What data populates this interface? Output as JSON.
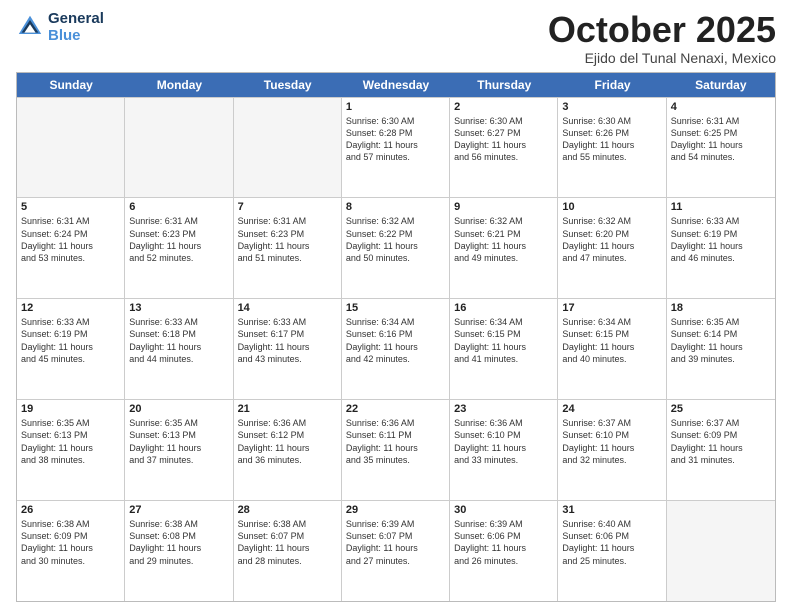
{
  "logo": {
    "line1": "General",
    "line2": "Blue"
  },
  "title": "October 2025",
  "location": "Ejido del Tunal Nenaxi, Mexico",
  "days": [
    "Sunday",
    "Monday",
    "Tuesday",
    "Wednesday",
    "Thursday",
    "Friday",
    "Saturday"
  ],
  "weeks": [
    [
      {
        "day": "",
        "info": ""
      },
      {
        "day": "",
        "info": ""
      },
      {
        "day": "",
        "info": ""
      },
      {
        "day": "1",
        "info": "Sunrise: 6:30 AM\nSunset: 6:28 PM\nDaylight: 11 hours\nand 57 minutes."
      },
      {
        "day": "2",
        "info": "Sunrise: 6:30 AM\nSunset: 6:27 PM\nDaylight: 11 hours\nand 56 minutes."
      },
      {
        "day": "3",
        "info": "Sunrise: 6:30 AM\nSunset: 6:26 PM\nDaylight: 11 hours\nand 55 minutes."
      },
      {
        "day": "4",
        "info": "Sunrise: 6:31 AM\nSunset: 6:25 PM\nDaylight: 11 hours\nand 54 minutes."
      }
    ],
    [
      {
        "day": "5",
        "info": "Sunrise: 6:31 AM\nSunset: 6:24 PM\nDaylight: 11 hours\nand 53 minutes."
      },
      {
        "day": "6",
        "info": "Sunrise: 6:31 AM\nSunset: 6:23 PM\nDaylight: 11 hours\nand 52 minutes."
      },
      {
        "day": "7",
        "info": "Sunrise: 6:31 AM\nSunset: 6:23 PM\nDaylight: 11 hours\nand 51 minutes."
      },
      {
        "day": "8",
        "info": "Sunrise: 6:32 AM\nSunset: 6:22 PM\nDaylight: 11 hours\nand 50 minutes."
      },
      {
        "day": "9",
        "info": "Sunrise: 6:32 AM\nSunset: 6:21 PM\nDaylight: 11 hours\nand 49 minutes."
      },
      {
        "day": "10",
        "info": "Sunrise: 6:32 AM\nSunset: 6:20 PM\nDaylight: 11 hours\nand 47 minutes."
      },
      {
        "day": "11",
        "info": "Sunrise: 6:33 AM\nSunset: 6:19 PM\nDaylight: 11 hours\nand 46 minutes."
      }
    ],
    [
      {
        "day": "12",
        "info": "Sunrise: 6:33 AM\nSunset: 6:19 PM\nDaylight: 11 hours\nand 45 minutes."
      },
      {
        "day": "13",
        "info": "Sunrise: 6:33 AM\nSunset: 6:18 PM\nDaylight: 11 hours\nand 44 minutes."
      },
      {
        "day": "14",
        "info": "Sunrise: 6:33 AM\nSunset: 6:17 PM\nDaylight: 11 hours\nand 43 minutes."
      },
      {
        "day": "15",
        "info": "Sunrise: 6:34 AM\nSunset: 6:16 PM\nDaylight: 11 hours\nand 42 minutes."
      },
      {
        "day": "16",
        "info": "Sunrise: 6:34 AM\nSunset: 6:15 PM\nDaylight: 11 hours\nand 41 minutes."
      },
      {
        "day": "17",
        "info": "Sunrise: 6:34 AM\nSunset: 6:15 PM\nDaylight: 11 hours\nand 40 minutes."
      },
      {
        "day": "18",
        "info": "Sunrise: 6:35 AM\nSunset: 6:14 PM\nDaylight: 11 hours\nand 39 minutes."
      }
    ],
    [
      {
        "day": "19",
        "info": "Sunrise: 6:35 AM\nSunset: 6:13 PM\nDaylight: 11 hours\nand 38 minutes."
      },
      {
        "day": "20",
        "info": "Sunrise: 6:35 AM\nSunset: 6:13 PM\nDaylight: 11 hours\nand 37 minutes."
      },
      {
        "day": "21",
        "info": "Sunrise: 6:36 AM\nSunset: 6:12 PM\nDaylight: 11 hours\nand 36 minutes."
      },
      {
        "day": "22",
        "info": "Sunrise: 6:36 AM\nSunset: 6:11 PM\nDaylight: 11 hours\nand 35 minutes."
      },
      {
        "day": "23",
        "info": "Sunrise: 6:36 AM\nSunset: 6:10 PM\nDaylight: 11 hours\nand 33 minutes."
      },
      {
        "day": "24",
        "info": "Sunrise: 6:37 AM\nSunset: 6:10 PM\nDaylight: 11 hours\nand 32 minutes."
      },
      {
        "day": "25",
        "info": "Sunrise: 6:37 AM\nSunset: 6:09 PM\nDaylight: 11 hours\nand 31 minutes."
      }
    ],
    [
      {
        "day": "26",
        "info": "Sunrise: 6:38 AM\nSunset: 6:09 PM\nDaylight: 11 hours\nand 30 minutes."
      },
      {
        "day": "27",
        "info": "Sunrise: 6:38 AM\nSunset: 6:08 PM\nDaylight: 11 hours\nand 29 minutes."
      },
      {
        "day": "28",
        "info": "Sunrise: 6:38 AM\nSunset: 6:07 PM\nDaylight: 11 hours\nand 28 minutes."
      },
      {
        "day": "29",
        "info": "Sunrise: 6:39 AM\nSunset: 6:07 PM\nDaylight: 11 hours\nand 27 minutes."
      },
      {
        "day": "30",
        "info": "Sunrise: 6:39 AM\nSunset: 6:06 PM\nDaylight: 11 hours\nand 26 minutes."
      },
      {
        "day": "31",
        "info": "Sunrise: 6:40 AM\nSunset: 6:06 PM\nDaylight: 11 hours\nand 25 minutes."
      },
      {
        "day": "",
        "info": ""
      }
    ]
  ]
}
